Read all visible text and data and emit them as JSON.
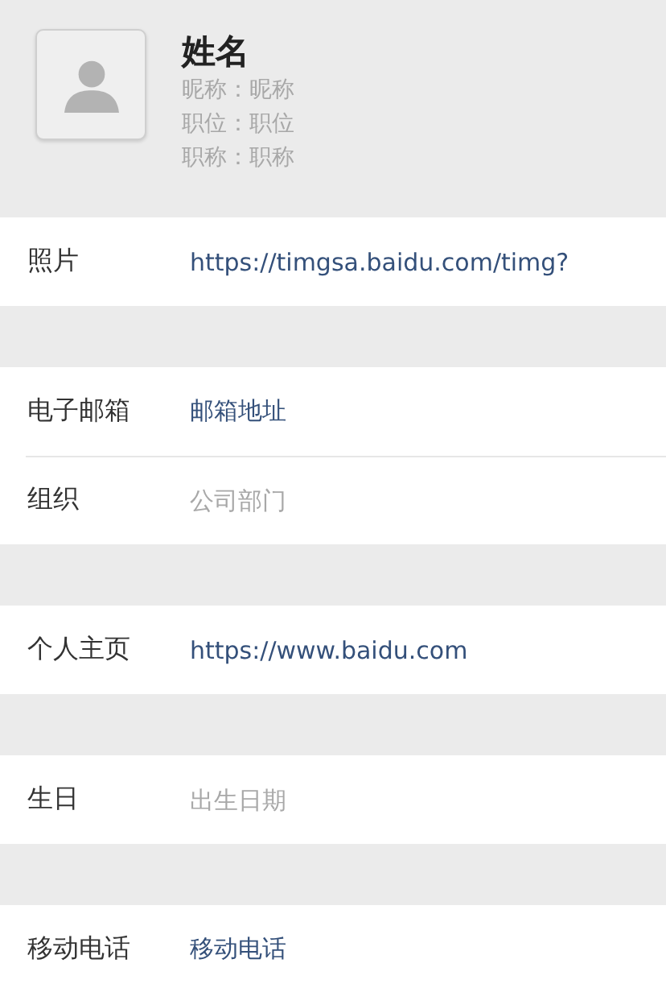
{
  "profile": {
    "name": "姓名",
    "details": [
      "昵称：昵称",
      "职位：职位",
      "职称：职称"
    ]
  },
  "groups": [
    [
      {
        "label": "照片",
        "value": "https://timgsa.baidu.com/timg?"
      }
    ],
    [
      {
        "label": "电子邮箱",
        "value": "邮箱地址"
      },
      {
        "label": "组织",
        "placeholder": "公司部门"
      }
    ],
    [
      {
        "label": "个人主页",
        "value": "https://www.baidu.com"
      }
    ],
    [
      {
        "label": "生日",
        "placeholder": "出生日期"
      }
    ],
    [
      {
        "label": "移动电话",
        "value": "移动电话"
      }
    ]
  ]
}
